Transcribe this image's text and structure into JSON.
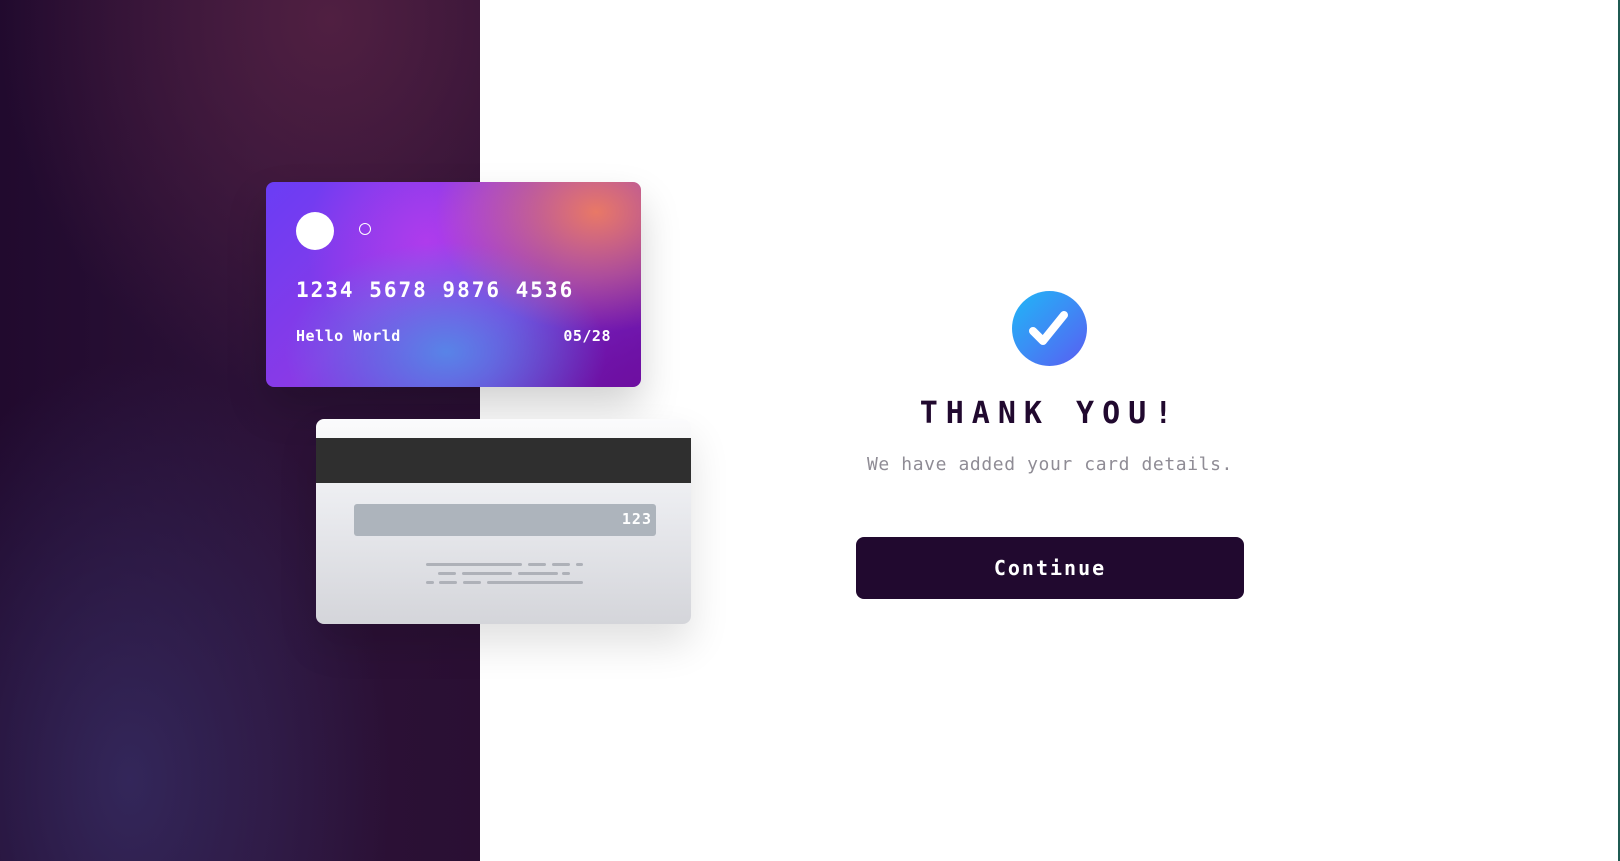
{
  "colors": {
    "brand_dark": "#21092f",
    "accent_gradient_start": "#1fb7f6",
    "accent_gradient_end": "#5a5cf2",
    "muted_text": "#8f8c95"
  },
  "card_front": {
    "number": "1234 5678 9876 4536",
    "holder_name": "Hello World",
    "expiry": "05/28"
  },
  "card_back": {
    "cvc": "123"
  },
  "confirmation": {
    "icon": "check-icon",
    "title": "THANK YOU!",
    "message": "We have added your card details.",
    "button_label": "Continue"
  }
}
